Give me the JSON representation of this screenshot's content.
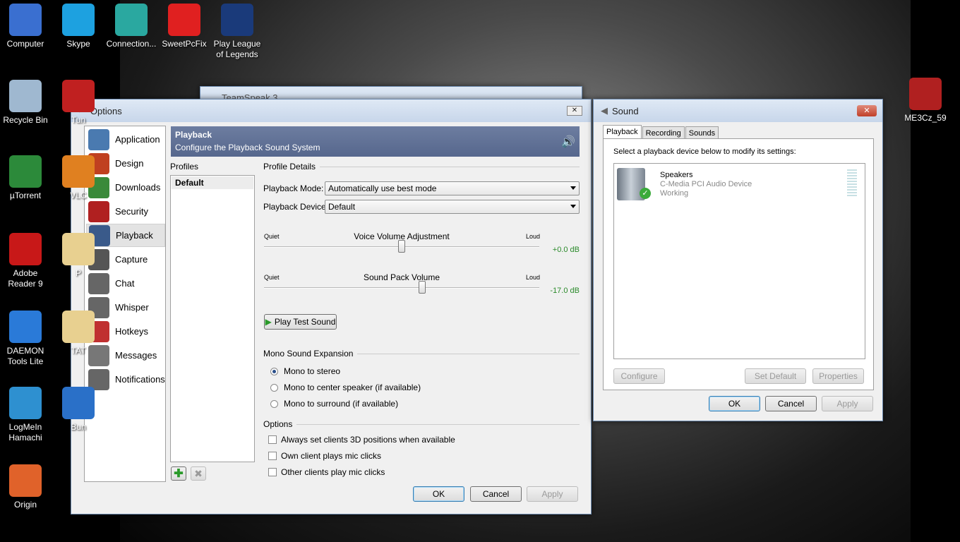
{
  "desktop": {
    "icons_left": [
      {
        "label": "Computer",
        "color": "#3a6fd0"
      },
      {
        "label": "Recycle Bin",
        "color": "#9fb8d0"
      },
      {
        "label": "µTorrent",
        "color": "#2c8a3a"
      },
      {
        "label": "Adobe Reader 9",
        "color": "#c81818"
      },
      {
        "label": "DAEMON Tools Lite",
        "color": "#2a7ad8"
      },
      {
        "label": "LogMeIn Hamachi",
        "color": "#2e90d0"
      },
      {
        "label": "Origin",
        "color": "#e0622a"
      }
    ],
    "icons_col2": [
      {
        "label": "Skype",
        "color": "#1da1e0"
      },
      {
        "label": "Tun",
        "color": "#c02020"
      },
      {
        "label": "VLC",
        "color": "#e08020"
      },
      {
        "label": "P",
        "color": "#e8d090"
      },
      {
        "label": "TAT",
        "color": "#e8d090"
      },
      {
        "label": "Bun",
        "color": "#2a70c8"
      }
    ],
    "icons_top": [
      {
        "label": "Connection...",
        "color": "#2aa8a0"
      },
      {
        "label": "SweetPcFix",
        "color": "#e02020"
      },
      {
        "label": "Play League of Legends",
        "color": "#1a3a7a"
      }
    ],
    "icon_right": {
      "label": "ME3Cz_59",
      "color": "#b02020"
    }
  },
  "teamspeak": {
    "title": "TeamSpeak 3"
  },
  "options": {
    "title": "Options",
    "sidebar": [
      "Application",
      "Design",
      "Downloads",
      "Security",
      "Playback",
      "Capture",
      "Chat",
      "Whisper",
      "Hotkeys",
      "Messages",
      "Notifications"
    ],
    "selected": "Playback",
    "header": {
      "title": "Playback",
      "subtitle": "Configure the Playback Sound System"
    },
    "profiles_label": "Profiles",
    "profiles": [
      "Default"
    ],
    "details_label": "Profile Details",
    "playback_mode_label": "Playback Mode:",
    "playback_mode_value": "Automatically use best mode",
    "playback_device_label": "Playback Device:",
    "playback_device_value": "Default",
    "voice_slider": {
      "title": "Voice Volume Adjustment",
      "min_label": "Quiet",
      "max_label": "Loud",
      "value_text": "+0.0 dB",
      "fraction": 0.5
    },
    "pack_slider": {
      "title": "Sound Pack Volume",
      "min_label": "Quiet",
      "max_label": "Loud",
      "value_text": "-17.0 dB",
      "fraction": 0.575
    },
    "play_test": "Play Test Sound",
    "mono_label": "Mono Sound Expansion",
    "mono_options": [
      "Mono to stereo",
      "Mono to center speaker (if available)",
      "Mono to surround (if available)"
    ],
    "options_label": "Options",
    "checkboxes": [
      "Always set clients 3D positions when available",
      "Own client plays mic clicks",
      "Other clients play mic clicks"
    ],
    "ok": "OK",
    "cancel": "Cancel",
    "apply": "Apply",
    "value_color": "#2a8a2a"
  },
  "sound": {
    "title": "Sound",
    "tabs": [
      "Playback",
      "Recording",
      "Sounds"
    ],
    "instruction": "Select a playback device below to modify its settings:",
    "device": {
      "name": "Speakers",
      "driver": "C-Media PCI Audio Device",
      "status": "Working"
    },
    "configure": "Configure",
    "set_default": "Set Default",
    "properties": "Properties",
    "ok": "OK",
    "cancel": "Cancel",
    "apply": "Apply"
  }
}
